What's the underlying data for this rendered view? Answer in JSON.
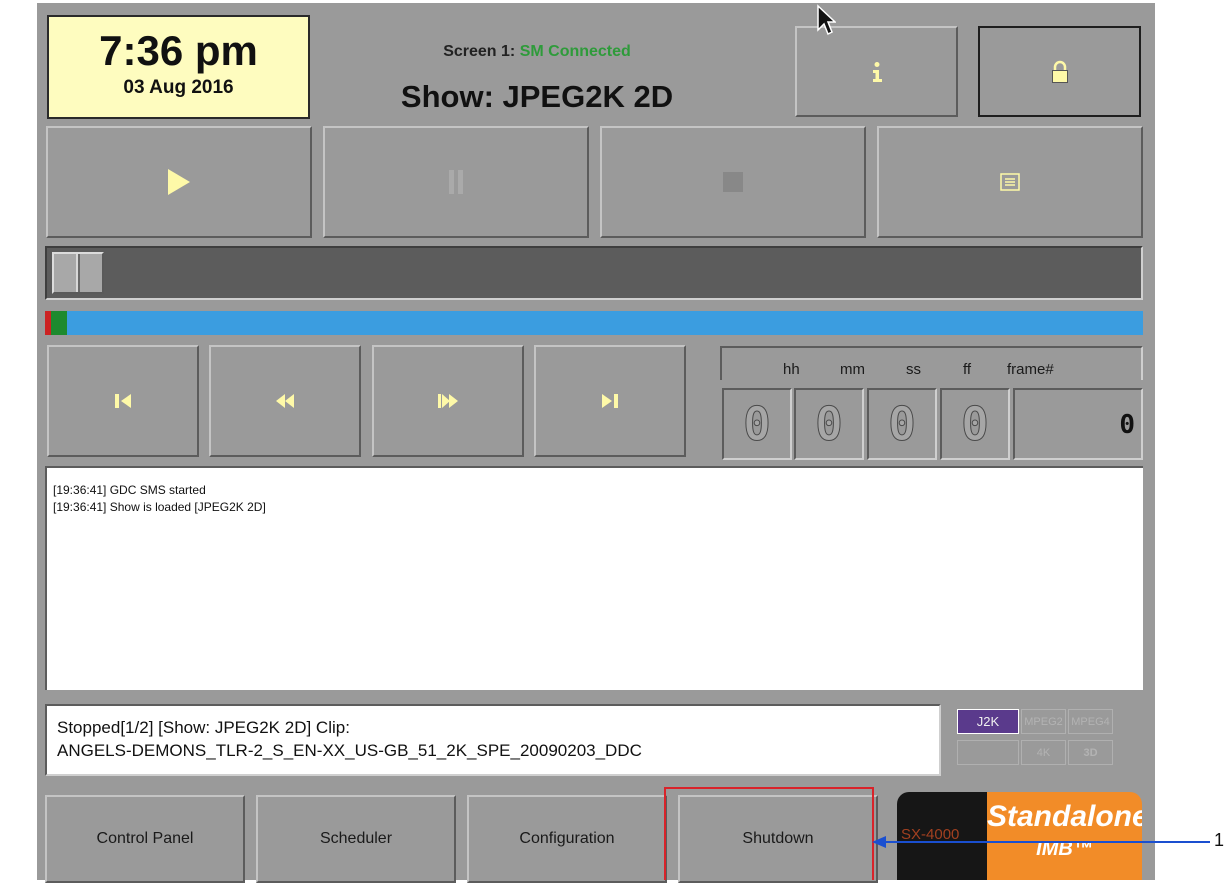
{
  "clock": {
    "time": "7:36 pm",
    "date": "03 Aug 2016"
  },
  "status": {
    "screen_label": "Screen 1:",
    "sm_status": "SM Connected",
    "show": "Show: JPEG2K 2D"
  },
  "top_buttons": {
    "info_icon": "info-icon",
    "lock_icon": "lock-icon"
  },
  "transport": [
    "play-icon",
    "pause-icon",
    "stop-icon",
    "playlist-icon"
  ],
  "navigation": [
    "skip-to-start-icon",
    "rewind-icon",
    "fast-forward-icon",
    "skip-to-end-icon"
  ],
  "timecode": {
    "headers": {
      "hh": "hh",
      "mm": "mm",
      "ss": "ss",
      "ff": "ff",
      "frame": "frame#"
    },
    "hh": "0",
    "mm": "0",
    "ss": "0",
    "ff": "0",
    "frame": "0"
  },
  "log": {
    "line1": "[19:36:41] GDC SMS started",
    "line2": "[19:36:41] Show is loaded [JPEG2K 2D]"
  },
  "status_box": {
    "line1": "Stopped[1/2] [Show: JPEG2K 2D] Clip:",
    "line2": "ANGELS-DEMONS_TLR-2_S_EN-XX_US-GB_51_2K_SPE_20090203_DDC"
  },
  "formats": {
    "j2k": "J2K",
    "mpeg2": "MPEG2",
    "mpeg4": "MPEG4",
    "k4": "4K",
    "d3": "3D"
  },
  "bottom_nav": {
    "control_panel": "Control Panel",
    "scheduler": "Scheduler",
    "configuration": "Configuration",
    "shutdown": "Shutdown"
  },
  "logo": {
    "model": "SX-4000",
    "standalone": "Standalone",
    "imb": "IMB™"
  },
  "callout": {
    "label": "1"
  },
  "colors": {
    "panel": "#9a9a9a",
    "clock_bg": "#fefcbf",
    "connected": "#2e9b3a",
    "progress_bar": "#3b9de0",
    "j2k_active": "#5a3a8c",
    "logo_orange": "#f28c28",
    "highlight": "#d9232a",
    "callout_arrow": "#1a4fd0"
  }
}
